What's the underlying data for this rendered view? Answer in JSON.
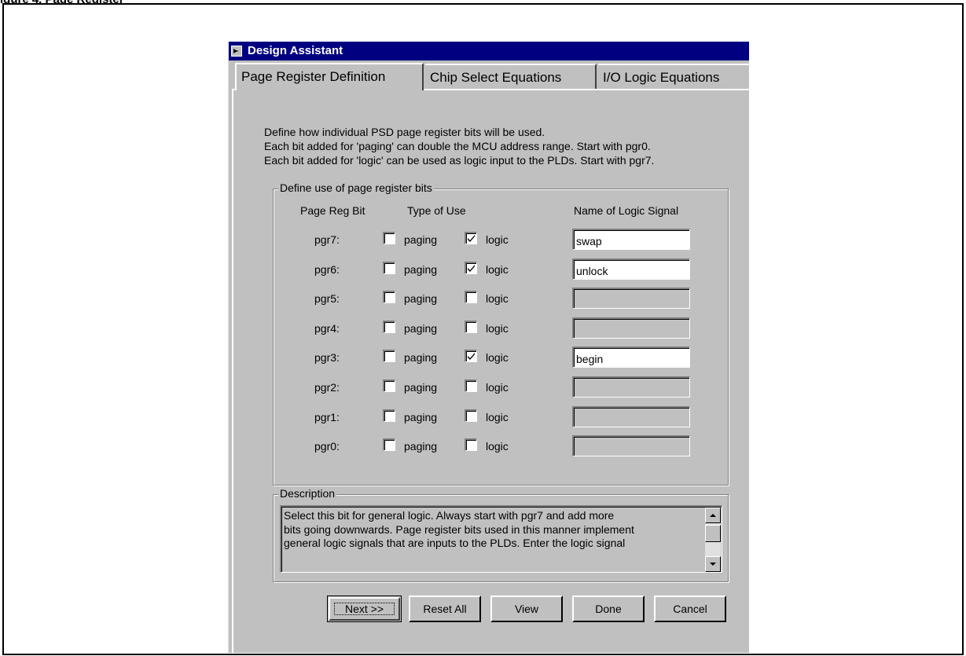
{
  "figure_caption_fragment": "igure 4. Page Register",
  "window": {
    "title": "Design Assistant"
  },
  "tabs": [
    {
      "label": "Page Register Definition",
      "active": true
    },
    {
      "label": "Chip Select Equations",
      "active": false
    },
    {
      "label": "I/O Logic Equations",
      "active": false
    }
  ],
  "intro_lines": [
    "Define how individual PSD page register bits will be used.",
    "Each bit added for 'paging' can double the MCU address range. Start with pgr0.",
    "Each bit added for 'logic' can be used as logic input to the PLDs. Start with pgr7."
  ],
  "page_reg_group": {
    "legend": "Define use of page register bits",
    "headers": {
      "bit": "Page Reg Bit",
      "type": "Type of Use",
      "name": "Name of Logic Signal"
    },
    "paging_label": "paging",
    "logic_label": "logic",
    "rows": [
      {
        "bit": "pgr7:",
        "paging": false,
        "logic": true,
        "signal": "swap",
        "enabled": true
      },
      {
        "bit": "pgr6:",
        "paging": false,
        "logic": true,
        "signal": "unlock",
        "enabled": true
      },
      {
        "bit": "pgr5:",
        "paging": false,
        "logic": false,
        "signal": "",
        "enabled": false
      },
      {
        "bit": "pgr4:",
        "paging": false,
        "logic": false,
        "signal": "",
        "enabled": false
      },
      {
        "bit": "pgr3:",
        "paging": false,
        "logic": true,
        "signal": "begin",
        "enabled": true
      },
      {
        "bit": "pgr2:",
        "paging": false,
        "logic": false,
        "signal": "",
        "enabled": false
      },
      {
        "bit": "pgr1:",
        "paging": false,
        "logic": false,
        "signal": "",
        "enabled": false
      },
      {
        "bit": "pgr0:",
        "paging": false,
        "logic": false,
        "signal": "",
        "enabled": false
      }
    ]
  },
  "description_group": {
    "legend": "Description",
    "lines": [
      "Select this bit for general logic.  Always start with pgr7 and add more",
      "bits going downwards.  Page register bits used in this manner implement",
      "general logic signals that are inputs to the PLDs.  Enter the logic signal"
    ]
  },
  "buttons": {
    "next": "Next >>",
    "reset": "Reset All",
    "view": "View",
    "done": "Done",
    "cancel": "Cancel"
  },
  "icons": {
    "title": "app-arrow-icon",
    "check": "checkmark-icon",
    "scroll_up": "scroll-up-arrow-icon",
    "scroll_down": "scroll-down-arrow-icon"
  },
  "colors": {
    "title_bar": "#000080",
    "face": "#c0c0c0",
    "field": "#ffffff"
  }
}
